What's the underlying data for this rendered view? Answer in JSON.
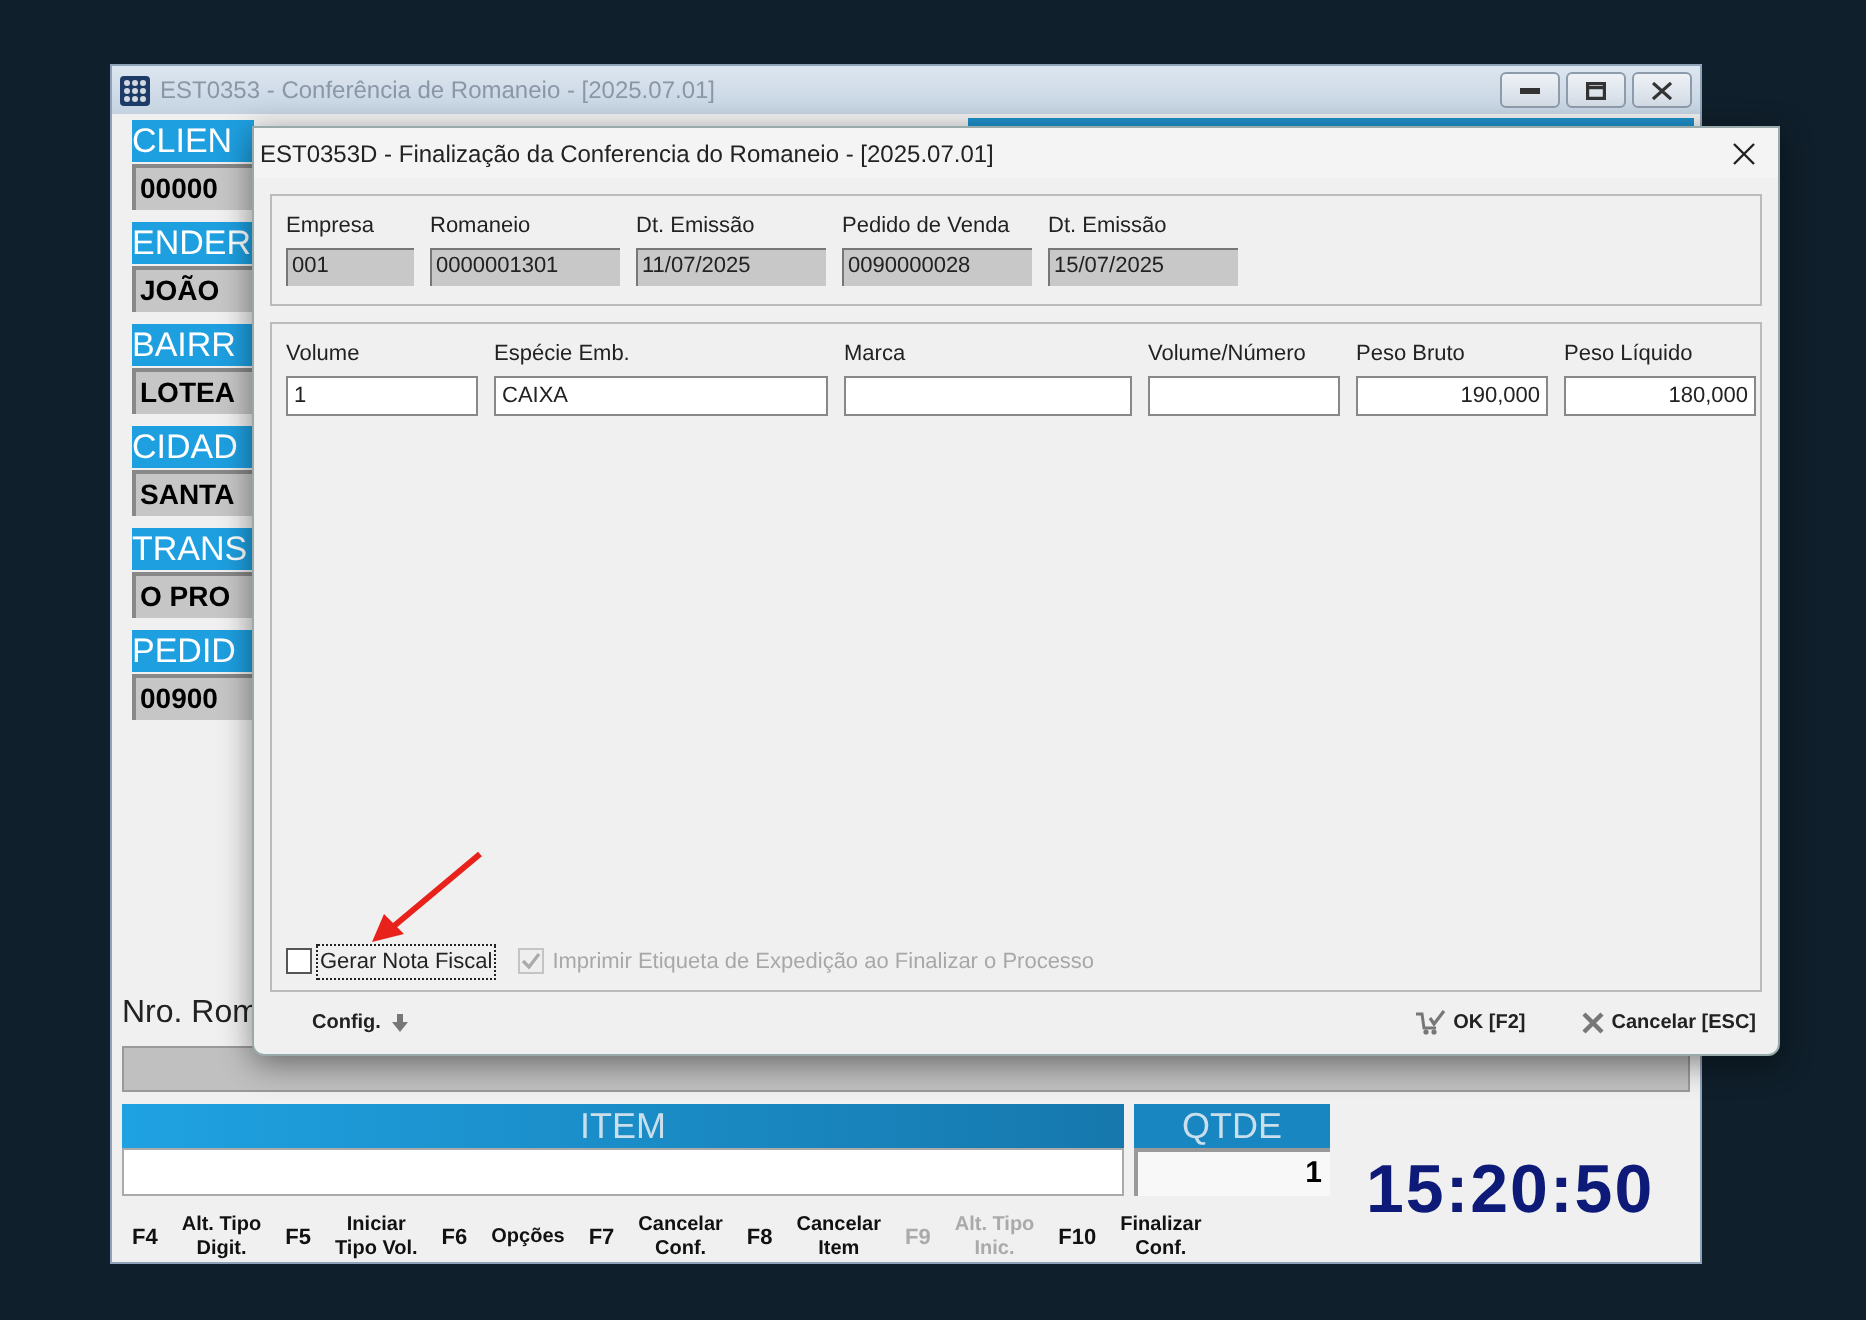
{
  "main_window": {
    "title": "EST0353 - Conferência de Romaneio - [2025.07.01]",
    "side_fields": [
      {
        "label": "CLIEN",
        "value": "00000"
      },
      {
        "label": "ENDER",
        "value": "JOÃO"
      },
      {
        "label": "BAIRR",
        "value": "LOTEA"
      },
      {
        "label": "CIDAD",
        "value": "SANTA"
      },
      {
        "label": "TRANS",
        "value": "O PRO"
      },
      {
        "label": "PEDID",
        "value": "00900"
      }
    ],
    "romaneio_label": "Nro. Rom",
    "item_header": "ITEM",
    "qty_header": "QTDE",
    "qty_value": "1",
    "clock": "15:20:50",
    "function_keys": [
      {
        "key": "F4",
        "label": "Alt. Tipo\nDigit.",
        "disabled": false
      },
      {
        "key": "F5",
        "label": "Iniciar\nTipo Vol.",
        "disabled": false
      },
      {
        "key": "F6",
        "label": "Opções",
        "disabled": false
      },
      {
        "key": "F7",
        "label": "Cancelar\nConf.",
        "disabled": false
      },
      {
        "key": "F8",
        "label": "Cancelar\nItem",
        "disabled": false
      },
      {
        "key": "F9",
        "label": "Alt. Tipo\nInic.",
        "disabled": true
      },
      {
        "key": "F10",
        "label": "Finalizar\nConf.",
        "disabled": false
      }
    ]
  },
  "dialog": {
    "title": "EST0353D - Finalização da Conferencia do Romaneio - [2025.07.01]",
    "header_fields": [
      {
        "label": "Empresa",
        "value": "001"
      },
      {
        "label": "Romaneio",
        "value": "0000001301"
      },
      {
        "label": "Dt. Emissão",
        "value": "11/07/2025"
      },
      {
        "label": "Pedido de Venda",
        "value": "0090000028"
      },
      {
        "label": "Dt. Emissão",
        "value": "15/07/2025"
      }
    ],
    "volume_fields": [
      {
        "label": "Volume",
        "value": "1",
        "kind": "text"
      },
      {
        "label": "Espécie Emb.",
        "value": "CAIXA",
        "kind": "text"
      },
      {
        "label": "Marca",
        "kind": "text"
      },
      {
        "label": "Volume/Número",
        "kind": "text"
      },
      {
        "label": "Peso Bruto",
        "value": "190,000",
        "kind": "number"
      },
      {
        "label": "Peso Líquido",
        "value": "180,000",
        "kind": "number"
      }
    ],
    "checkboxes": [
      {
        "label": "Gerar Nota Fiscal",
        "checked": false,
        "disabled": false,
        "focused": true
      },
      {
        "label": "Imprimir Etiqueta de Expedição ao Finalizar o Processo",
        "checked": true,
        "disabled": true,
        "focused": false
      }
    ],
    "config_button": "Config.",
    "buttons": [
      {
        "kind": "ok",
        "label": "OK [F2]"
      },
      {
        "kind": "cancel",
        "label": "Cancelar [ESC]"
      }
    ]
  }
}
